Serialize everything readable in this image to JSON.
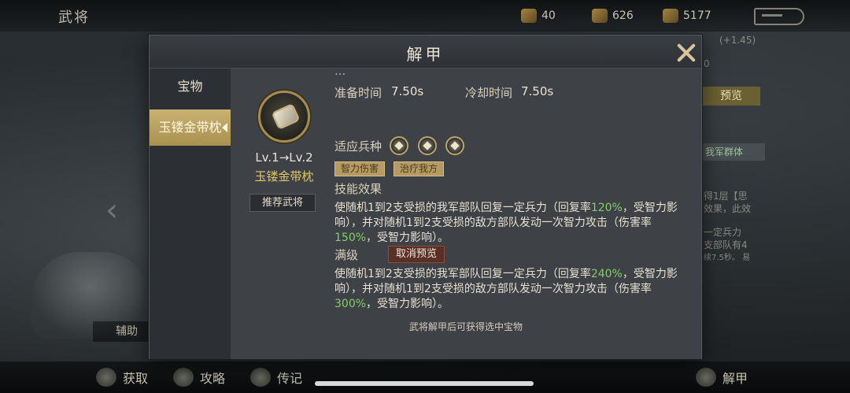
{
  "top": {
    "title": "武将",
    "resources": [
      {
        "icon": "ticket-icon",
        "value": "40"
      },
      {
        "icon": "coin-icon",
        "value": "626"
      },
      {
        "icon": "gem-icon",
        "value": "5177"
      }
    ]
  },
  "background": {
    "assist_label": "辅助",
    "right_texts": [
      "(+1.45)",
      "0",
      "我军群体",
      "得1层【思",
      "效果，此效",
      "一定兵力",
      "支部队有4",
      "续7.5秒。 易"
    ],
    "preview_label": "预览"
  },
  "modal": {
    "title": "解甲",
    "sidebar": {
      "items": [
        {
          "label": "宝物"
        },
        {
          "label": "玉镂金带枕"
        }
      ]
    },
    "treasure": {
      "level": "Lv.1→Lv.2",
      "name": "玉镂金带枕",
      "recommend_label": "推荐武将"
    },
    "stats": {
      "cut_top_left": "...",
      "prep_label": "准备时间",
      "prep_value": "7.50s",
      "cool_label": "冷却时间",
      "cool_value": "7.50s",
      "troop_label": "适应兵种",
      "troop_icons": [
        "cavalry-icon",
        "shield-icon",
        "archer-icon"
      ]
    },
    "tags": [
      "智力伤害",
      "治疗我方"
    ],
    "effect_title": "技能效果",
    "effect_desc": {
      "p1": "使随机1到2支受损的我军部队回复一定兵力（回复率",
      "v1": "120%",
      "p2": "，受智力影响），并对随机1到2支受损的敌方部队发动一次智力攻击（伤害率",
      "v2": "150%",
      "p3": "，受智力影响）。"
    },
    "max_label": "满级",
    "cancel_preview_label": "取消预览",
    "max_desc": {
      "p1": "使随机1到2支受损的我军部队回复一定兵力（回复率",
      "v1": "240%",
      "p2": "，受智力影响），并对随机1到2支受损的敌方部队发动一次智力攻击（伤害率",
      "v2": "300%",
      "p3": "，受智力影响）。"
    },
    "footer_note": "武将解甲后可获得选中宝物"
  },
  "bottom": {
    "items": [
      {
        "label": "获取",
        "icon": "acquire-icon"
      },
      {
        "label": "攻略",
        "icon": "guide-book-icon"
      },
      {
        "label": "传记",
        "icon": "biography-icon"
      }
    ],
    "right_label": "解甲",
    "right_icon": "disarm-icon"
  },
  "colors": {
    "accent_gold": "#c9b272",
    "highlight_green": "#7fd06a",
    "name_yellow": "#e2c76a"
  }
}
